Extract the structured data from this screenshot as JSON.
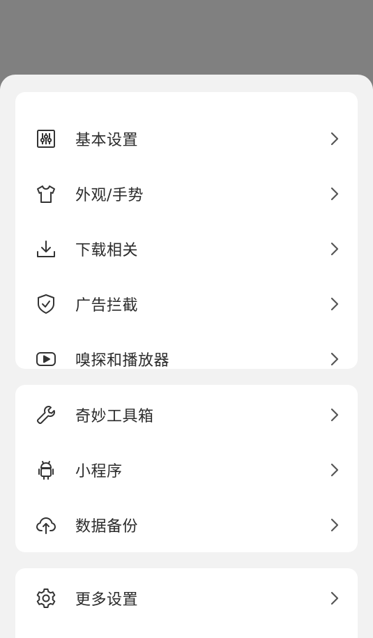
{
  "colors": {
    "scrim": "#808080",
    "sheet_bg": "#f2f2f2",
    "card_bg": "#ffffff",
    "text": "#2b2b2b",
    "icon": "#333333",
    "chevron": "#555555"
  },
  "groups": [
    {
      "items": [
        {
          "label": "基本设置",
          "icon": "sliders-icon"
        },
        {
          "label": "外观/手势",
          "icon": "tshirt-icon"
        },
        {
          "label": "下载相关",
          "icon": "download-icon"
        },
        {
          "label": "广告拦截",
          "icon": "shield-check-icon"
        },
        {
          "label": "嗅探和播放器",
          "icon": "play-icon"
        }
      ]
    },
    {
      "items": [
        {
          "label": "奇妙工具箱",
          "icon": "wrench-icon"
        },
        {
          "label": "小程序",
          "icon": "android-icon"
        },
        {
          "label": "数据备份",
          "icon": "cloud-upload-icon"
        }
      ]
    },
    {
      "items": [
        {
          "label": "更多设置",
          "icon": "gear-icon"
        }
      ]
    }
  ]
}
